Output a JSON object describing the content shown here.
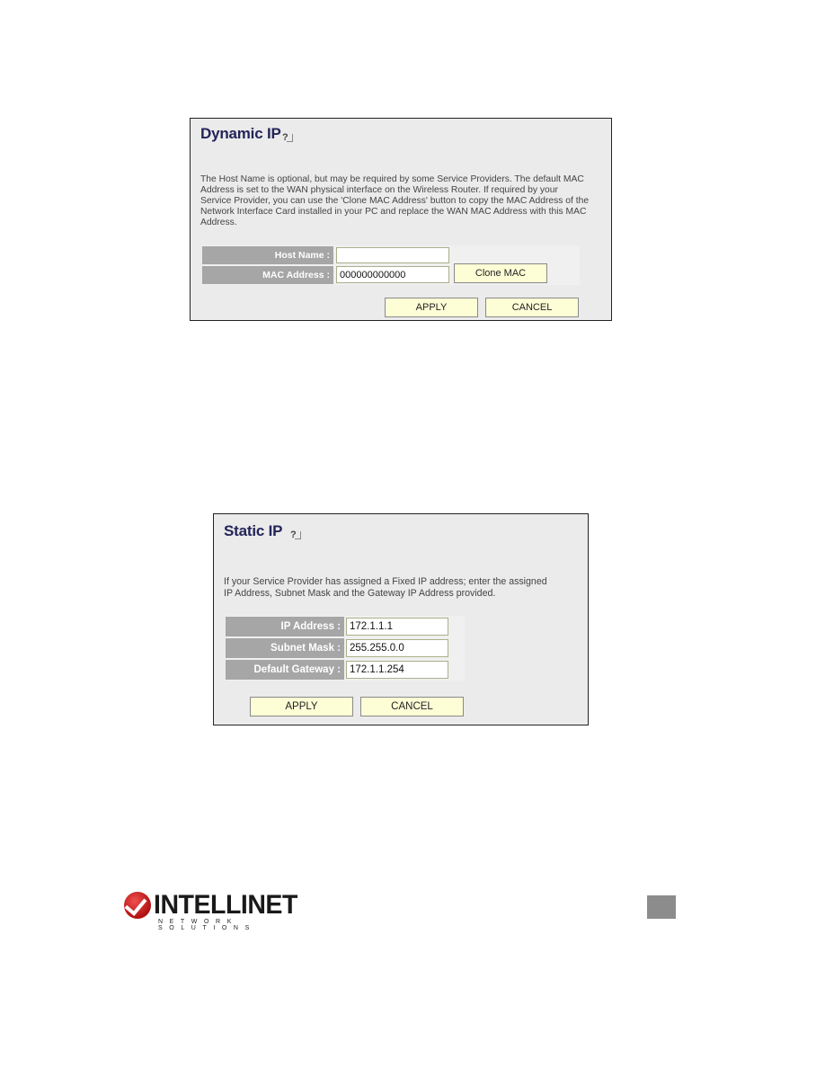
{
  "dynamic_ip": {
    "title": "Dynamic IP",
    "help_icon": "help-icon",
    "description": [
      "The Host Name is optional, but may be required by some Service Providers. The default MAC",
      "Address is set to the WAN physical interface on the Wireless Router. If required by your",
      "Service Provider, you can use the 'Clone MAC Address' button to copy the MAC Address of the",
      "Network Interface Card installed in your PC and replace the WAN MAC Address with this MAC",
      "Address."
    ],
    "fields": [
      {
        "label": "Host Name :",
        "value": "",
        "placeholder": ""
      },
      {
        "label": "MAC Address :",
        "value": "000000000000",
        "placeholder": ""
      }
    ],
    "clone_mac_label": "Clone MAC",
    "apply_label": "APPLY",
    "cancel_label": "CANCEL"
  },
  "static_ip": {
    "title": "Static IP",
    "help_icon": "help-icon",
    "description": [
      "If your Service Provider has assigned a Fixed IP address; enter the assigned",
      "IP Address, Subnet Mask and the Gateway IP Address provided."
    ],
    "fields": [
      {
        "label": "IP Address :",
        "value": "172.1.1.1"
      },
      {
        "label": "Subnet Mask :",
        "value": "255.255.0.0"
      },
      {
        "label": "Default Gateway :",
        "value": "172.1.1.254"
      }
    ],
    "apply_label": "APPLY",
    "cancel_label": "CANCEL"
  },
  "footer": {
    "brand": "INTELLINET",
    "tagline": "NETWORK SOLUTIONS",
    "logo_icon": "checkmark-icon",
    "brand_color": "#c8171d"
  }
}
